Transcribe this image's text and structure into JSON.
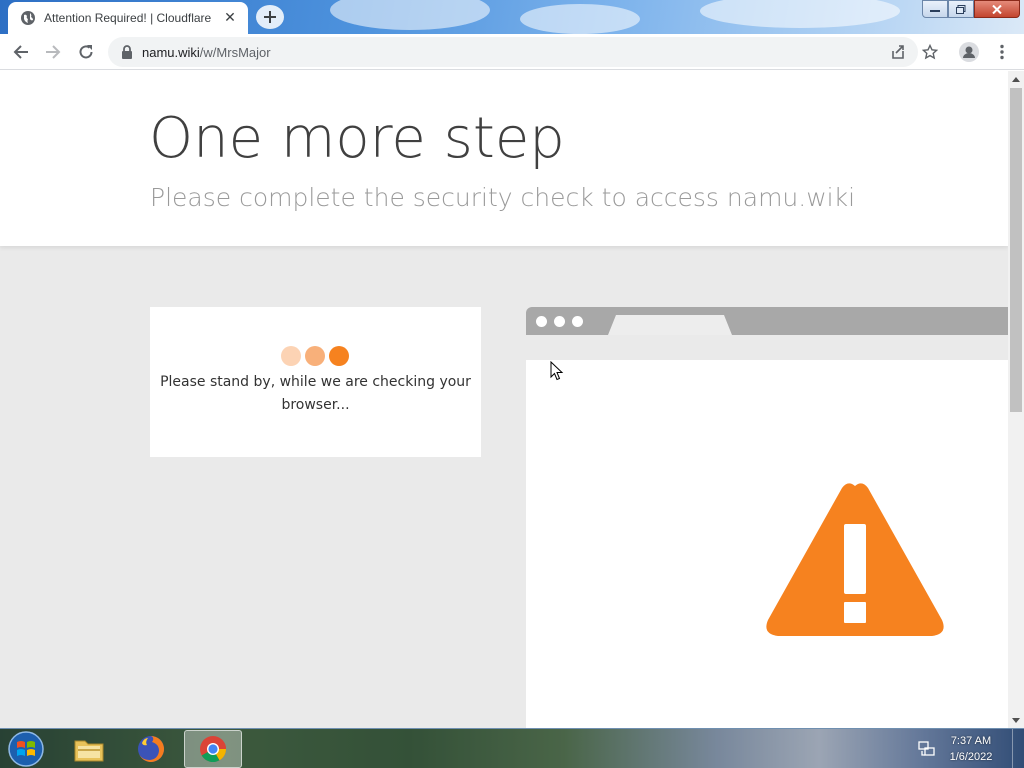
{
  "browser": {
    "tab_title": "Attention Required! | Cloudflare",
    "url_domain": "namu.wiki",
    "url_path": "/w/MrsMajor"
  },
  "page": {
    "headline": "One more step",
    "subline": "Please complete the security check to access namu.wiki",
    "check_message": "Please stand by, while we are checking your browser...",
    "dot_colors": [
      "#fcd3b4",
      "#f8b07a",
      "#f6821f"
    ],
    "warning_color": "#f6821f"
  },
  "taskbar": {
    "apps": [
      "Windows Explorer",
      "Firefox",
      "Google Chrome"
    ],
    "time": "7:37 AM",
    "date": "1/6/2022"
  }
}
